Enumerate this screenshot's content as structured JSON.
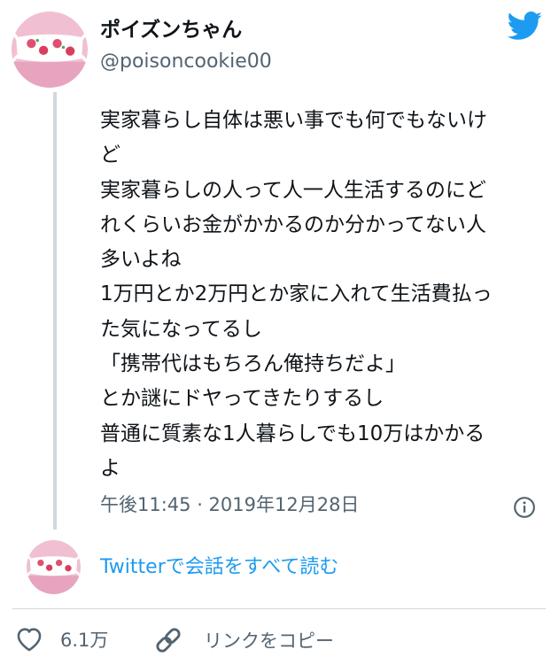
{
  "author": {
    "display_name": "ポイズンちゃん",
    "handle": "@poisoncookie00"
  },
  "tweet": {
    "lines": [
      "実家暮らし自体は悪い事でも何でもないけ",
      "ど",
      "実家暮らしの人って人一人生活するのにど",
      "れくらいお金がかかるのか分かってない人",
      "多いよね",
      "1万円とか2万円とか家に入れて生活費払っ",
      "た気になってるし",
      "「携帯代はもちろん俺持ちだよ」",
      "とか謎にドヤってきたりするし",
      "普通に質素な1人暮らしでも10万はかかる",
      "よ"
    ],
    "timestamp": "午後11:45 · 2019年12月28日"
  },
  "conversation": {
    "link_label": "Twitterで会話をすべて読む"
  },
  "actions": {
    "like_count": "6.1万",
    "copy_link_label": "リンクをコピー"
  },
  "icons": {
    "brand": "twitter-bird-icon",
    "info": "info-icon",
    "like": "heart-icon",
    "copy": "link-icon"
  },
  "colors": {
    "twitter_blue": "#1d9bf0",
    "text_primary": "#0f1419",
    "text_secondary": "#536471",
    "thread_line": "#cfd9de"
  }
}
